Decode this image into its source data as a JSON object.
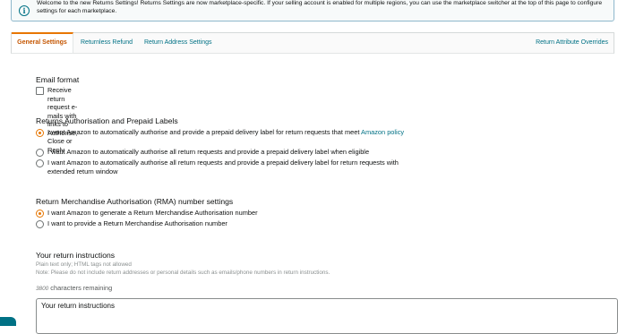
{
  "banner": {
    "icon": "info-icon",
    "text": "Welcome to the new Returns Settings! Returns Settings are now marketplace-specific. If your selling account is enabled for multiple regions, you can use the marketplace switcher at the top of this page to configure settings for each marketplace."
  },
  "tabs": [
    {
      "label": "General Settings",
      "active": true
    },
    {
      "label": "Returnless Refund",
      "active": false
    },
    {
      "label": "Return Address Settings",
      "active": false
    },
    {
      "label": "Return Attribute Overrides",
      "active": false
    }
  ],
  "email": {
    "title": "Email format",
    "checkbox_label": "Receive return request e-mails with links to Authorise, Close or Reply",
    "checked": false
  },
  "authorisation": {
    "title": "Returns Authorisation and Prepaid Labels",
    "options": [
      {
        "label": "I want Amazon to automatically authorise and provide a prepaid delivery label for return requests that meet ",
        "link": "Amazon policy",
        "selected": true
      },
      {
        "label": "I want Amazon to automatically authorise all return requests and provide a prepaid delivery label when eligible",
        "selected": false
      },
      {
        "label": "I want Amazon to automatically authorise all return requests and provide a prepaid delivery label for return requests with extended return window",
        "selected": false
      }
    ]
  },
  "rma": {
    "title": "Return Merchandise Authorisation (RMA) number settings",
    "options": [
      {
        "label": "I want Amazon to generate a Return Merchandise Authorisation number",
        "selected": true
      },
      {
        "label": "I want to provide a Return Merchandise Authorisation number",
        "selected": false
      }
    ]
  },
  "instructions": {
    "title": "Your return instructions",
    "hint1": "Plain text only; HTML tags not allowed",
    "hint2": "Note: Please do not include return addresses or personal details such as emails/phone numbers in return instructions.",
    "remaining_count": "3800",
    "remaining_label": " characters remaining",
    "placeholder": "Your return instructions"
  },
  "colors": {
    "accent": "#e77600",
    "link": "#007185",
    "active_tab": "#c45500"
  }
}
